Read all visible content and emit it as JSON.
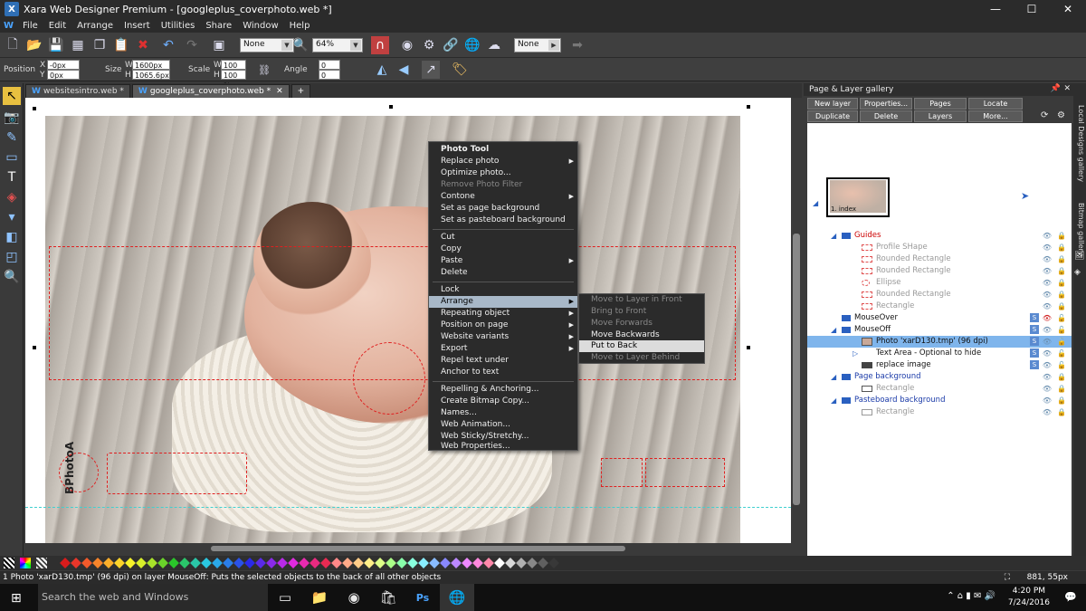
{
  "window": {
    "title": "Xara Web Designer Premium - [googleplus_coverphoto.web *]",
    "minimize": "—",
    "maximize": "☐",
    "close": "✕"
  },
  "menu": {
    "logo": "W",
    "items": [
      "File",
      "Edit",
      "Arrange",
      "Insert",
      "Utilities",
      "Share",
      "Window",
      "Help"
    ]
  },
  "toolbar": {
    "quality_select": "None",
    "zoom_select": "64%",
    "snap_select": "None"
  },
  "infobar": {
    "position_label": "Position",
    "x_label": "X",
    "x_value": "-0px",
    "y_label": "Y",
    "y_value": "0px",
    "size_label": "Size",
    "w_label": "W",
    "w_value": "1600px",
    "h_label": "H",
    "h_value": "1065.6px",
    "scale_label": "Scale",
    "scale_w_label": "W",
    "scale_w": "100 %",
    "scale_h_label": "H",
    "scale_h": "100 %",
    "angle_label": "Angle",
    "angle_1": "0",
    "angle_2": "0"
  },
  "tabs": [
    {
      "icon": "W",
      "label": "websitesintro.web *"
    },
    {
      "icon": "W",
      "label": "googleplus_coverphoto.web *"
    }
  ],
  "tab_add": "+",
  "photo_watermark": "BPhotoA",
  "context_menu": {
    "items": [
      {
        "label": "Photo Tool",
        "bold": true
      },
      {
        "label": "Replace photo",
        "sub": true
      },
      {
        "label": "Optimize photo..."
      },
      {
        "label": "Remove Photo Filter",
        "disabled": true
      },
      {
        "label": "Contone",
        "sub": true
      },
      {
        "label": "Set as page background"
      },
      {
        "label": "Set as pasteboard background"
      },
      {
        "label": "Cut"
      },
      {
        "label": "Copy"
      },
      {
        "label": "Paste",
        "sub": true
      },
      {
        "label": "Delete"
      },
      {
        "label": "Lock"
      },
      {
        "label": "Arrange",
        "sub": true,
        "highlight": true
      },
      {
        "label": "Repeating object",
        "sub": true
      },
      {
        "label": "Position on page",
        "sub": true
      },
      {
        "label": "Website variants",
        "sub": true
      },
      {
        "label": "Export",
        "sub": true
      },
      {
        "label": "Repel text under"
      },
      {
        "label": "Anchor to text"
      },
      {
        "label": "Repelling & Anchoring..."
      },
      {
        "label": "Create Bitmap Copy..."
      },
      {
        "label": "Names..."
      },
      {
        "label": "Web Animation..."
      },
      {
        "label": "Web Sticky/Stretchy..."
      },
      {
        "label": "Web Properties..."
      }
    ],
    "arrange_submenu": [
      {
        "label": "Move to Layer in Front",
        "disabled": true
      },
      {
        "label": "Bring to Front",
        "disabled": true
      },
      {
        "label": "Move Forwards",
        "disabled": true
      },
      {
        "label": "Move Backwards"
      },
      {
        "label": "Put to Back",
        "highlight": true
      },
      {
        "label": "Move to Layer Behind",
        "disabled": true
      }
    ]
  },
  "layer_gallery": {
    "title": "Page & Layer gallery",
    "buttons_row1": [
      "New layer",
      "Properties...",
      "Pages",
      "Locate"
    ],
    "buttons_row2": [
      "Duplicate",
      "Delete",
      "Layers",
      "More..."
    ],
    "page_thumb_label": "1. index",
    "rows": [
      {
        "label": "Guides",
        "style": "red",
        "indent": 0,
        "layer": true
      },
      {
        "label": "Profile SHape",
        "style": "grey",
        "indent": 2
      },
      {
        "label": "Rounded Rectangle",
        "style": "grey",
        "indent": 2
      },
      {
        "label": "Rounded Rectangle",
        "style": "grey",
        "indent": 2
      },
      {
        "label": "Ellipse",
        "style": "grey",
        "indent": 2
      },
      {
        "label": "Rounded Rectangle",
        "style": "grey",
        "indent": 2
      },
      {
        "label": "Rectangle",
        "style": "grey",
        "indent": 2
      },
      {
        "label": "MouseOver",
        "style": "black",
        "indent": 0,
        "layer": true
      },
      {
        "label": "MouseOff",
        "style": "black",
        "indent": 0,
        "layer": true
      },
      {
        "label": "Photo 'xarD130.tmp' (96 dpi)",
        "style": "sel",
        "indent": 2
      },
      {
        "label": "Text Area - Optional to hide",
        "style": "black",
        "indent": 2
      },
      {
        "label": "replace image",
        "style": "black",
        "indent": 2
      },
      {
        "label": "Page background",
        "style": "blue",
        "indent": 0,
        "layer": true
      },
      {
        "label": "Rectangle",
        "style": "grey",
        "indent": 2
      },
      {
        "label": "Pasteboard background",
        "style": "blue",
        "indent": 0,
        "layer": true
      },
      {
        "label": "Rectangle",
        "style": "grey",
        "indent": 2
      }
    ]
  },
  "side_tabs": [
    "Local Designs gallery",
    "Bitmap gallery"
  ],
  "palette_colors": [
    "#d91c1c",
    "#e8362a",
    "#f25a2b",
    "#f7842a",
    "#fbae2a",
    "#fcd32a",
    "#f6f22a",
    "#d8ef2a",
    "#a8e22a",
    "#6ad32a",
    "#2ac62a",
    "#2ac66a",
    "#2ac6a8",
    "#2ac6e0",
    "#2aa8e8",
    "#2a7ee8",
    "#2a52e8",
    "#2a2ae8",
    "#5a2ae8",
    "#8a2ae8",
    "#b82ae8",
    "#e02ae0",
    "#e82ab0",
    "#e82a80",
    "#e82a52",
    "#ff8888",
    "#ffaa88",
    "#ffcc88",
    "#ffee88",
    "#ddff88",
    "#aaff88",
    "#88ffaa",
    "#88ffdd",
    "#88eeff",
    "#88bbff",
    "#8888ff",
    "#bb88ff",
    "#ee88ff",
    "#ff88dd",
    "#ff88aa",
    "#ffffff",
    "#d8d8d8",
    "#b0b0b0",
    "#888888",
    "#606060",
    "#383838"
  ],
  "status": {
    "message": "1 Photo 'xarD130.tmp' (96 dpi) on layer MouseOff: Puts the selected objects to the back of all other objects",
    "coords": "881, 55px"
  },
  "taskbar": {
    "search": "Search the web and Windows",
    "time": "4:20 PM",
    "date": "7/24/2016"
  }
}
